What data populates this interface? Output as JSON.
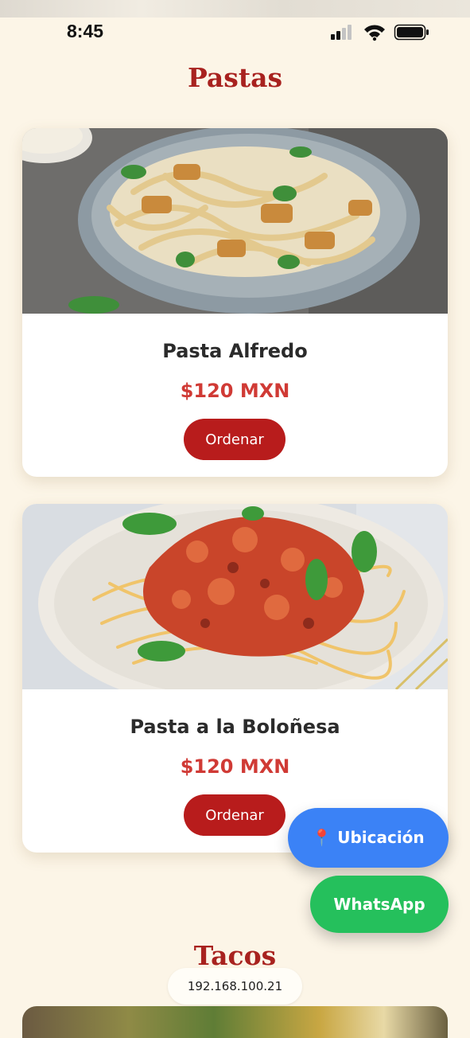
{
  "status_bar": {
    "time": "8:45"
  },
  "sections": [
    {
      "title": "Pastas"
    },
    {
      "title": "Tacos"
    }
  ],
  "menu_items": [
    {
      "name": "Pasta Alfredo",
      "price": "$120 MXN",
      "order_label": "Ordenar"
    },
    {
      "name": "Pasta a la Boloñesa",
      "price": "$120 MXN",
      "order_label": "Ordenar"
    }
  ],
  "floating_buttons": {
    "location_label": "Ubicación",
    "location_icon": "map-pin-icon",
    "whatsapp_label": "WhatsApp"
  },
  "address_bar": {
    "url": "192.168.100.21"
  },
  "colors": {
    "background": "#fcf5e7",
    "title_red": "#a8221f",
    "price_red": "#d03a35",
    "order_button": "#b81c1c",
    "location_button": "#3b82f6",
    "whatsapp_button": "#25c05c"
  }
}
